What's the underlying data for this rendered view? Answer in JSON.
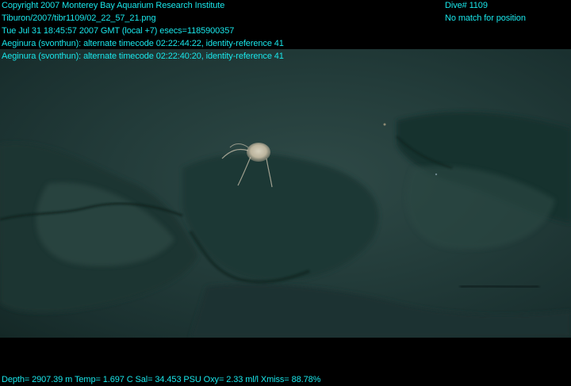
{
  "overlay": {
    "copyright": "Copyright 2007 Monterey Bay Aquarium Research Institute",
    "file_path": "Tiburon/2007/tibr1109/02_22_57_21.png",
    "timestamp": "Tue Jul 31 18:45:57 2007 GMT (local +7)  esecs=1185900357",
    "annotation_1": "Aeginura (svonthun): alternate timecode 02:22:44:22, identity-reference 41",
    "annotation_2": "Aeginura (svonthun): alternate timecode 02:22:40:20, identity-reference 41",
    "dive": "Dive# 1109",
    "position": "No match for position",
    "sensors": "Depth= 2907.39 m  Temp= 1.697 C  Sal= 34.453 PSU  Oxy= 2.33 ml/l  Xmiss= 88.78%"
  },
  "colors": {
    "overlay_text": "#19e6ea",
    "background": "#000000",
    "seafloor": "#233c3a"
  },
  "scene": {
    "subject": "jellyfish"
  }
}
